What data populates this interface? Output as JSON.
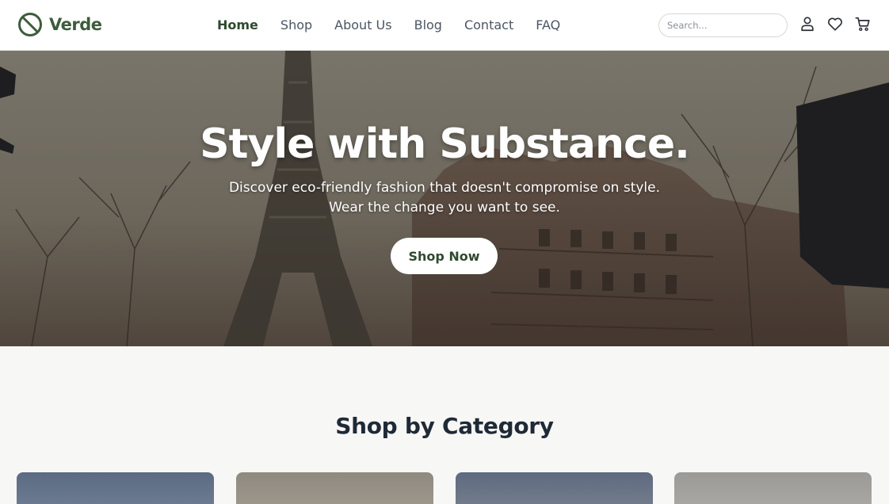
{
  "brand": {
    "name": "Verde"
  },
  "nav": {
    "links": [
      {
        "label": "Home",
        "active": true
      },
      {
        "label": "Shop",
        "active": false
      },
      {
        "label": "About Us",
        "active": false
      },
      {
        "label": "Blog",
        "active": false
      },
      {
        "label": "Contact",
        "active": false
      },
      {
        "label": "FAQ",
        "active": false
      }
    ],
    "search_placeholder": "Search...",
    "icons": [
      "user-icon",
      "heart-icon",
      "cart-icon"
    ]
  },
  "hero": {
    "title": "Style with Substance.",
    "subtitle": "Discover eco-friendly fashion that doesn't compromise on style. Wear the change you want to see.",
    "cta_label": "Shop Now",
    "image": "eiffel-tower-parisian-street-photo"
  },
  "categories": {
    "title": "Shop by Category"
  },
  "colors": {
    "brand_green": "#3d5c3d",
    "text_dark": "#1f2a37",
    "page_bg": "#f7f7f5"
  }
}
